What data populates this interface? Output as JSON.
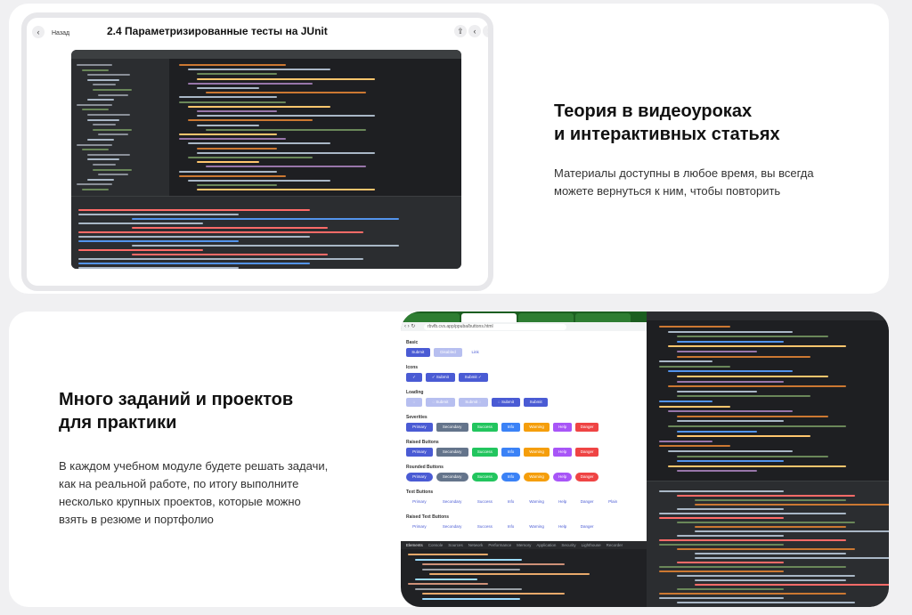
{
  "lesson": {
    "back_label": "Назад",
    "title": "2.4 Параметризированные тесты на JUnit"
  },
  "section1": {
    "heading_lines": [
      "Теория в видеоуроках",
      "и интерактивных статьях"
    ],
    "text_lines": [
      "Материалы доступны в любое время, вы всегда",
      "можете вернуться к ним, чтобы повторить"
    ]
  },
  "section2": {
    "heading_lines": [
      "Много заданий и проектов",
      "для практики"
    ],
    "text_lines": [
      "В каждом учебном модуле будете решать задачи,",
      "как на реальной работе, по итогу выполните",
      "несколько крупных проектов, которые можно",
      "взять в резюме и портфолио"
    ]
  },
  "browser": {
    "url": "rbvfb.cvs.app/ppuba/buttons.html",
    "groups": [
      {
        "label": "Basic",
        "buttons": [
          {
            "t": "Submit",
            "c": "#4a5bd4"
          },
          {
            "t": "Disabled",
            "c": "#b7bff0"
          },
          {
            "t": "Link",
            "c": "none"
          }
        ]
      },
      {
        "label": "Icons",
        "buttons": [
          {
            "t": "✓",
            "c": "#4a5bd4"
          },
          {
            "t": "✓ Submit",
            "c": "#4a5bd4"
          },
          {
            "t": "Submit ✓",
            "c": "#4a5bd4"
          }
        ]
      },
      {
        "label": "Loading",
        "buttons": [
          {
            "t": "◌",
            "c": "#b7bff0"
          },
          {
            "t": "◌ Submit",
            "c": "#b7bff0"
          },
          {
            "t": "Submit ◌",
            "c": "#b7bff0"
          },
          {
            "t": "◌ Submit",
            "c": "#4a5bd4"
          },
          {
            "t": "Submit",
            "c": "#4a5bd4"
          }
        ]
      },
      {
        "label": "Severities",
        "buttons": [
          {
            "t": "Primary",
            "c": "#4a5bd4"
          },
          {
            "t": "Secondary",
            "c": "#64748b"
          },
          {
            "t": "Success",
            "c": "#22c55e"
          },
          {
            "t": "Info",
            "c": "#3b82f6"
          },
          {
            "t": "Warning",
            "c": "#f59e0b"
          },
          {
            "t": "Help",
            "c": "#a855f7"
          },
          {
            "t": "Danger",
            "c": "#ef4444"
          }
        ]
      },
      {
        "label": "Raised Buttons",
        "buttons": [
          {
            "t": "Primary",
            "c": "#4a5bd4"
          },
          {
            "t": "Secondary",
            "c": "#64748b"
          },
          {
            "t": "Success",
            "c": "#22c55e"
          },
          {
            "t": "Info",
            "c": "#3b82f6"
          },
          {
            "t": "Warning",
            "c": "#f59e0b"
          },
          {
            "t": "Help",
            "c": "#a855f7"
          },
          {
            "t": "Danger",
            "c": "#ef4444"
          }
        ]
      },
      {
        "label": "Rounded Buttons",
        "buttons": [
          {
            "t": "Primary",
            "c": "#4a5bd4"
          },
          {
            "t": "Secondary",
            "c": "#64748b"
          },
          {
            "t": "Success",
            "c": "#22c55e"
          },
          {
            "t": "Info",
            "c": "#3b82f6"
          },
          {
            "t": "Warning",
            "c": "#f59e0b"
          },
          {
            "t": "Help",
            "c": "#a855f7"
          },
          {
            "t": "Danger",
            "c": "#ef4444"
          }
        ]
      },
      {
        "label": "Text Buttons",
        "buttons": [
          {
            "t": "Primary",
            "c": "text"
          },
          {
            "t": "Secondary",
            "c": "text"
          },
          {
            "t": "Success",
            "c": "text"
          },
          {
            "t": "Info",
            "c": "text"
          },
          {
            "t": "Warning",
            "c": "text"
          },
          {
            "t": "Help",
            "c": "text"
          },
          {
            "t": "Danger",
            "c": "text"
          },
          {
            "t": "Plain",
            "c": "text"
          }
        ]
      },
      {
        "label": "Raised Text Buttons",
        "buttons": [
          {
            "t": "Primary",
            "c": "text"
          },
          {
            "t": "Secondary",
            "c": "text"
          },
          {
            "t": "Success",
            "c": "text"
          },
          {
            "t": "Info",
            "c": "text"
          },
          {
            "t": "Warning",
            "c": "text"
          },
          {
            "t": "Help",
            "c": "text"
          },
          {
            "t": "Danger",
            "c": "text"
          }
        ]
      }
    ],
    "devtools_tabs": [
      "Elements",
      "Console",
      "Sources",
      "Network",
      "Performance",
      "Memory",
      "Application",
      "Security",
      "Lighthouse",
      "Recorder"
    ]
  },
  "colors": {
    "page_bg": "#f0f0f2",
    "card_bg": "#ffffff",
    "ide_bg": "#1e1f22",
    "browser_tabbar": "#1b5e20"
  }
}
